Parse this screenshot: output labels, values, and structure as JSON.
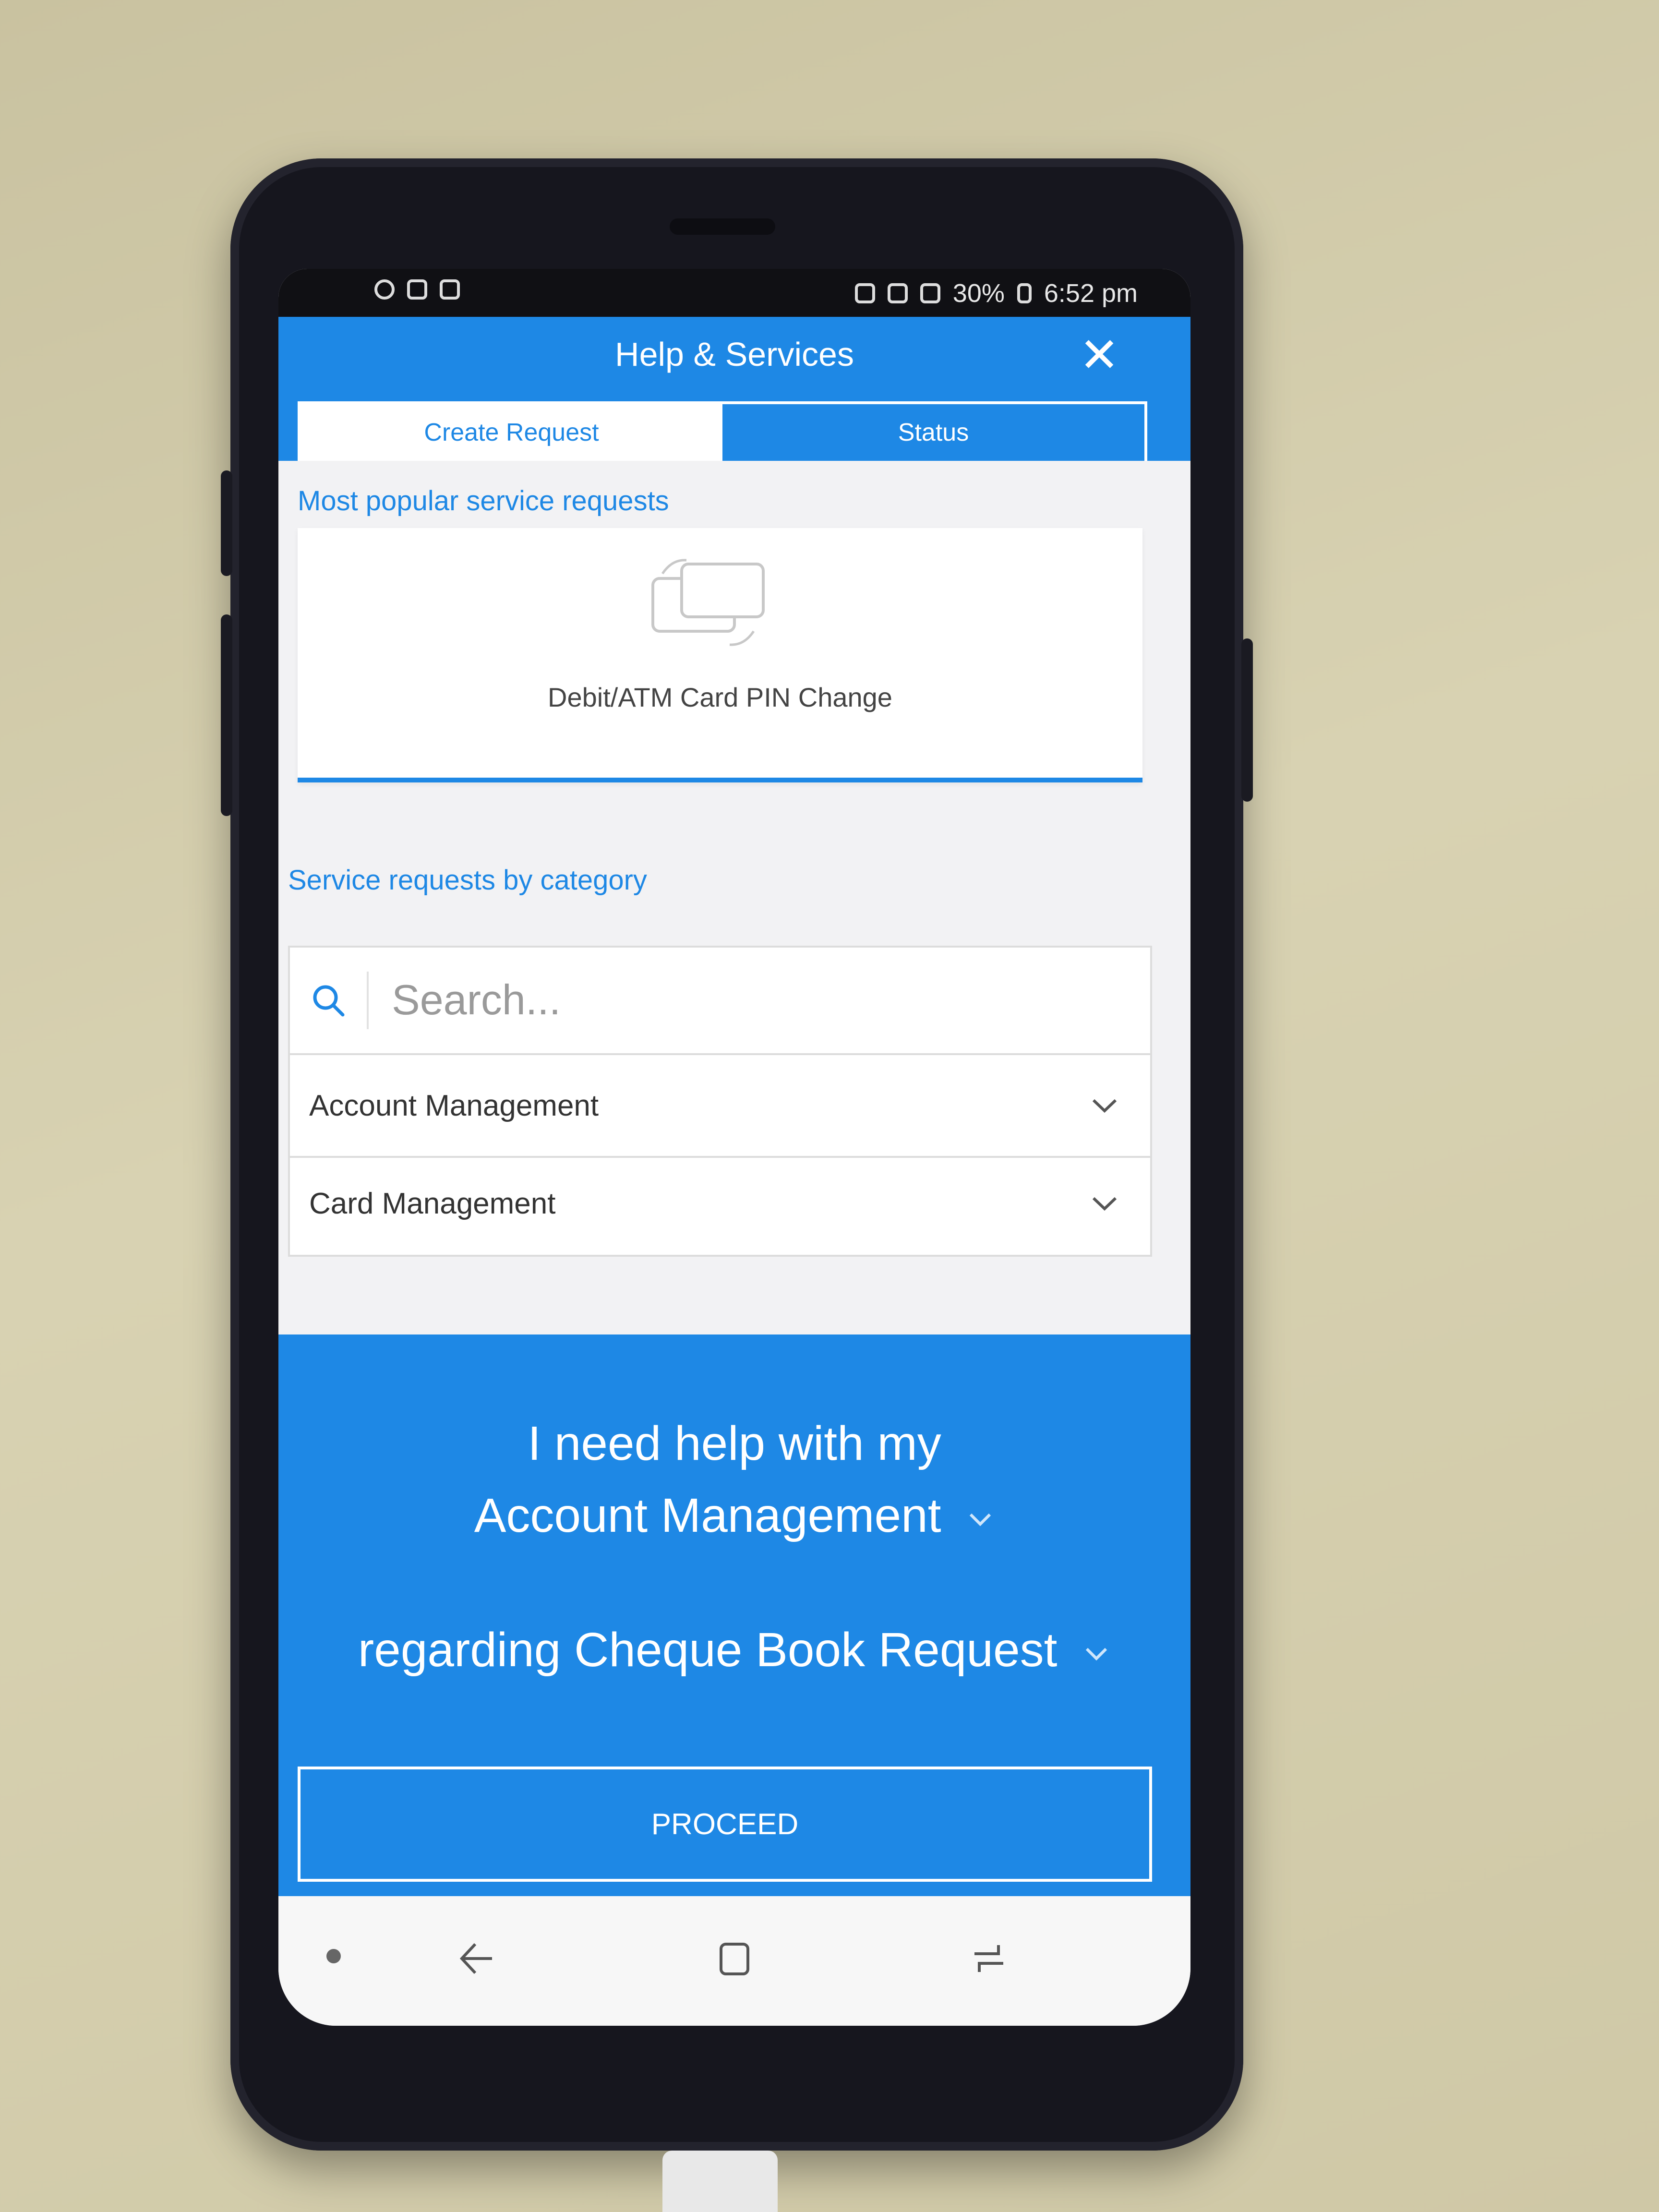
{
  "statusbar": {
    "battery": "30%",
    "time": "6:52 pm"
  },
  "header": {
    "title": "Help & Services",
    "close_icon": "close-icon"
  },
  "tabs": [
    {
      "label": "Create Request",
      "active": true
    },
    {
      "label": "Status",
      "active": false
    }
  ],
  "popular": {
    "section_label": "Most popular service requests",
    "card_label": "Debit/ATM Card PIN Change",
    "card_icon": "card-swap-icon"
  },
  "category": {
    "section_label": "Service requests by category",
    "search_placeholder": "Search...",
    "items": [
      {
        "label": "Account Management"
      },
      {
        "label": "Card Management"
      }
    ]
  },
  "help_panel": {
    "line1": "I need help with my",
    "topic": "Account Management",
    "regarding": "regarding",
    "subtopic": "Cheque Book Request",
    "proceed_label": "PROCEED"
  },
  "colors": {
    "primary": "#1e88e5",
    "background": "#f2f2f4"
  }
}
